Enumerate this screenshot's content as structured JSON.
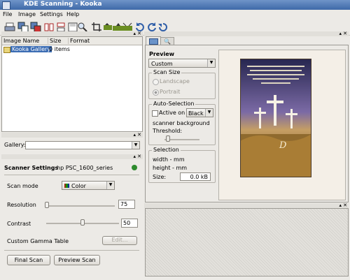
{
  "window": {
    "title": "KDE Scanning - Kooka"
  },
  "menu": [
    "File",
    "Image",
    "Settings",
    "Help"
  ],
  "toolbar_icons": [
    "print-icon",
    "copy-icon",
    "copy-icon",
    "mirror-horizontal-icon",
    "mirror-vertical-icon",
    "save-icon",
    "zoom-icon",
    "crop-icon",
    "scale-icon",
    "scale-original-icon",
    "scale-fit-icon",
    "rotate-right-icon",
    "rotate-left-icon",
    "rotate-180-icon"
  ],
  "gallery_table": {
    "columns": [
      "Image Name",
      "Size",
      "Format"
    ],
    "rows": [
      {
        "name": "Kooka Gallery",
        "size": "0 items",
        "format": ""
      }
    ]
  },
  "gallery_combo": {
    "label": "Gallery:",
    "value": ""
  },
  "scanner": {
    "title": "Scanner Settings",
    "device": "hp PSC_1600_series",
    "status_color": "#2e8b2e",
    "scan_mode_label": "Scan mode",
    "scan_mode_value": "Color",
    "resolution_label": "Resolution",
    "resolution_value": "75",
    "contrast_label": "Contrast",
    "contrast_value": "50",
    "gamma_label": "Custom Gamma Table",
    "edit_button": "Edit...",
    "final_scan": "Final Scan",
    "preview_scan": "Preview Scan"
  },
  "preview": {
    "title": "Preview",
    "size_combo": "Custom",
    "scan_size_title": "Scan Size",
    "landscape": "Landscape",
    "portrait": "Portrait",
    "auto_title": "Auto-Selection",
    "active_on": "Active on",
    "bg_combo": "Black",
    "scanner_bg": "scanner background",
    "threshold": "Threshold:",
    "selection_title": "Selection",
    "width_text": "width - mm",
    "height_text": "height - mm",
    "size_label": "Size:",
    "size_value": "0.0 kB"
  }
}
